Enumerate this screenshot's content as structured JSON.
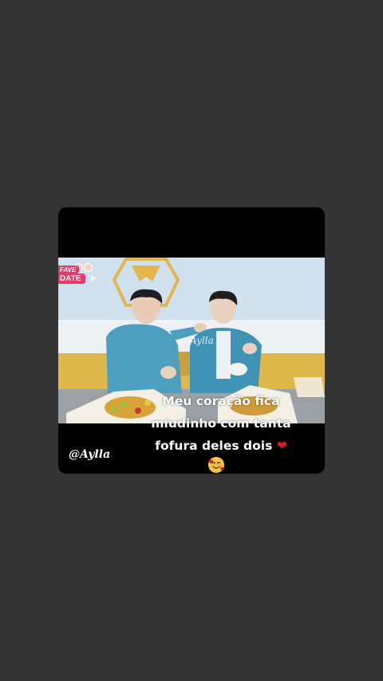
{
  "post": {
    "username": "@Aylla",
    "caption_line1": "Meu coração fica",
    "caption_line2": "miudinho com tanta",
    "caption_line3": "fofura deles dois",
    "caption_heart": "❤",
    "caption_emoji_icon": "smiling-face-with-hearts-icon"
  },
  "video": {
    "show_logo_top": "FAVE",
    "show_logo_bottom": "DATE",
    "watermark": "Aylla"
  }
}
